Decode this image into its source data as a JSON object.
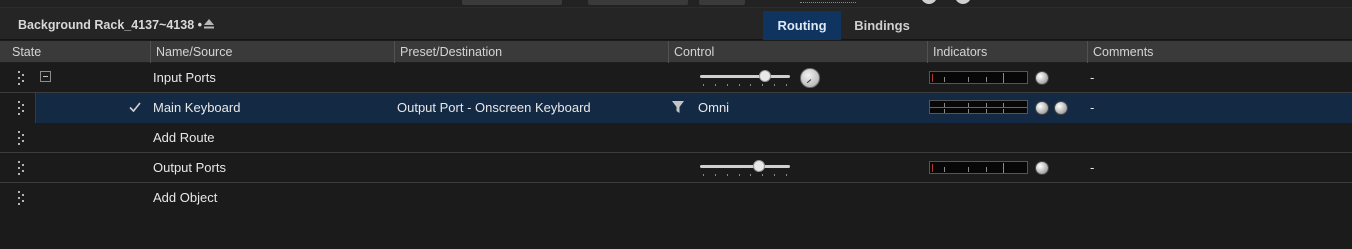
{
  "header": {
    "rack_title": "Background Rack_4137~4138 •",
    "tabs": [
      {
        "label": "Routing",
        "active": true
      },
      {
        "label": "Bindings",
        "active": false
      }
    ]
  },
  "columns": [
    "State",
    "Name/Source",
    "Preset/Destination",
    "Control",
    "Indicators",
    "Comments"
  ],
  "rows": [
    {
      "kind": "group",
      "name": "Input Ports",
      "destination": "",
      "control": "",
      "comment": "-"
    },
    {
      "kind": "route",
      "name": "Main Keyboard",
      "destination": "Output Port - Onscreen Keyboard",
      "control": "Omni",
      "comment": "-",
      "selected": true,
      "enabled": true
    },
    {
      "kind": "action",
      "name": "Add Route",
      "destination": "",
      "control": "",
      "comment": ""
    },
    {
      "kind": "group",
      "name": "Output Ports",
      "destination": "",
      "control": "",
      "comment": "-"
    },
    {
      "kind": "action",
      "name": "Add Object",
      "destination": "",
      "control": "",
      "comment": ""
    }
  ],
  "colors": {
    "accent_tab": "#0f3460",
    "selected_row": "#142a44",
    "background": "#1b1b1b",
    "header_bg": "#3a3a3a"
  },
  "icons": [
    "eject-icon",
    "collapse-icon",
    "check-icon",
    "filter-icon",
    "drag-handle-icon",
    "led-indicator",
    "volume-knob"
  ]
}
